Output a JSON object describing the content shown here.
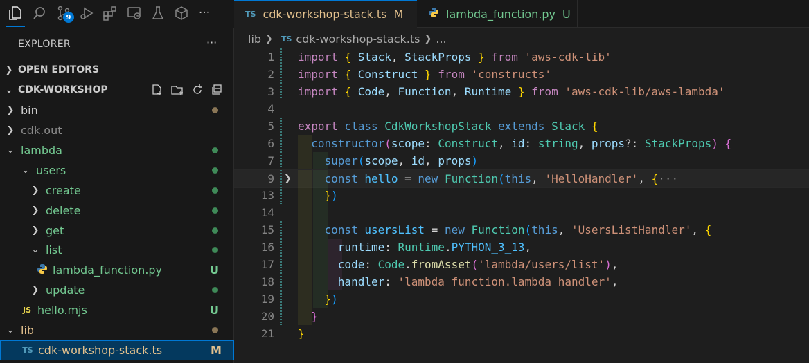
{
  "activity": {
    "badge_count": "9",
    "more": "···"
  },
  "sidebar": {
    "title": "EXPLORER",
    "more": "···",
    "open_editors": "OPEN EDITORS",
    "workspace": "CDK-WORKSHOP",
    "tree": [
      {
        "label": "bin",
        "status": ""
      },
      {
        "label": "cdk.out",
        "status": ""
      },
      {
        "label": "lambda",
        "status": ""
      },
      {
        "label": "users",
        "status": ""
      },
      {
        "label": "create",
        "status": ""
      },
      {
        "label": "delete",
        "status": ""
      },
      {
        "label": "get",
        "status": ""
      },
      {
        "label": "list",
        "status": ""
      },
      {
        "label": "lambda_function.py",
        "status": "U"
      },
      {
        "label": "update",
        "status": ""
      },
      {
        "label": "hello.mjs",
        "status": "U",
        "icon": "JS"
      },
      {
        "label": "lib",
        "status": ""
      },
      {
        "label": "cdk-workshop-stack.ts",
        "status": "M",
        "icon": "TS"
      }
    ]
  },
  "tabs": [
    {
      "label": "cdk-workshop-stack.ts",
      "status": "M",
      "icon": "TS"
    },
    {
      "label": "lambda_function.py",
      "status": "U"
    }
  ],
  "breadcrumb": {
    "folder": "lib",
    "icon": "TS",
    "file": "cdk-workshop-stack.ts",
    "tail": "..."
  },
  "editor": {
    "line_numbers": [
      "1",
      "2",
      "3",
      "4",
      "5",
      "6",
      "7",
      "9",
      "13",
      "14",
      "15",
      "16",
      "17",
      "18",
      "19",
      "20",
      "21"
    ],
    "lines": [
      {
        "t": [
          [
            "import ",
            "kw"
          ],
          [
            "{ ",
            "b1"
          ],
          [
            "Stack",
            "var"
          ],
          [
            ", ",
            ""
          ],
          [
            "StackProps",
            "var"
          ],
          [
            " }",
            "b1"
          ],
          [
            " from ",
            "kw"
          ],
          [
            "'aws-cdk-lib'",
            "str"
          ]
        ]
      },
      {
        "t": [
          [
            "import ",
            "kw"
          ],
          [
            "{ ",
            "b1"
          ],
          [
            "Construct",
            "var"
          ],
          [
            " }",
            "b1"
          ],
          [
            " from ",
            "kw"
          ],
          [
            "'constructs'",
            "str"
          ]
        ]
      },
      {
        "t": [
          [
            "import ",
            "kw"
          ],
          [
            "{ ",
            "b1"
          ],
          [
            "Code",
            "var"
          ],
          [
            ", ",
            ""
          ],
          [
            "Function",
            "var"
          ],
          [
            ", ",
            ""
          ],
          [
            "Runtime",
            "var"
          ],
          [
            " }",
            "b1"
          ],
          [
            " from ",
            "kw"
          ],
          [
            "'aws-cdk-lib/aws-lambda'",
            "str"
          ]
        ]
      },
      {
        "t": []
      },
      {
        "t": [
          [
            "export ",
            "kw"
          ],
          [
            "class ",
            "kwb"
          ],
          [
            "CdkWorkshopStack ",
            "tp"
          ],
          [
            "extends ",
            "kwb"
          ],
          [
            "Stack ",
            "tp"
          ],
          [
            "{",
            "b1"
          ]
        ]
      },
      {
        "t": [
          [
            "  ",
            ""
          ],
          [
            "constructor",
            "kwb"
          ],
          [
            "(",
            "b2"
          ],
          [
            "scope",
            "var"
          ],
          [
            ": ",
            ""
          ],
          [
            "Construct",
            "tp"
          ],
          [
            ", ",
            ""
          ],
          [
            "id",
            "var"
          ],
          [
            ": ",
            ""
          ],
          [
            "string",
            "tp"
          ],
          [
            ", ",
            ""
          ],
          [
            "props",
            "var"
          ],
          [
            "?: ",
            ""
          ],
          [
            "StackProps",
            "tp"
          ],
          [
            ")",
            "b2"
          ],
          [
            " {",
            "b2"
          ]
        ]
      },
      {
        "t": [
          [
            "    ",
            ""
          ],
          [
            "super",
            "kwb"
          ],
          [
            "(",
            "b3"
          ],
          [
            "scope",
            "var"
          ],
          [
            ", ",
            ""
          ],
          [
            "id",
            "var"
          ],
          [
            ", ",
            ""
          ],
          [
            "props",
            "var"
          ],
          [
            ")",
            "b3"
          ]
        ]
      },
      {
        "t": [
          [
            "    ",
            ""
          ],
          [
            "const ",
            "kwb"
          ],
          [
            "hello",
            "const"
          ],
          [
            " = ",
            ""
          ],
          [
            "new ",
            "kwb"
          ],
          [
            "Function",
            "tp"
          ],
          [
            "(",
            "b3"
          ],
          [
            "this",
            "kwb"
          ],
          [
            ", ",
            ""
          ],
          [
            "'HelloHandler'",
            "str"
          ],
          [
            ", ",
            ""
          ],
          [
            "{",
            "b1"
          ],
          [
            "···",
            "ellipsis"
          ]
        ]
      },
      {
        "t": [
          [
            "    ",
            ""
          ],
          [
            "}",
            "b1"
          ],
          [
            ")",
            "b3"
          ]
        ]
      },
      {
        "t": []
      },
      {
        "t": [
          [
            "    ",
            ""
          ],
          [
            "const ",
            "kwb"
          ],
          [
            "usersList",
            "const"
          ],
          [
            " = ",
            ""
          ],
          [
            "new ",
            "kwb"
          ],
          [
            "Function",
            "tp"
          ],
          [
            "(",
            "b3"
          ],
          [
            "this",
            "kwb"
          ],
          [
            ", ",
            ""
          ],
          [
            "'UsersListHandler'",
            "str"
          ],
          [
            ", ",
            ""
          ],
          [
            "{",
            "b1"
          ]
        ]
      },
      {
        "t": [
          [
            "      ",
            ""
          ],
          [
            "runtime",
            "var"
          ],
          [
            ": ",
            ""
          ],
          [
            "Runtime",
            "tp"
          ],
          [
            ".",
            ""
          ],
          [
            "PYTHON_3_13",
            "const"
          ],
          [
            ",",
            ""
          ]
        ]
      },
      {
        "t": [
          [
            "      ",
            ""
          ],
          [
            "code",
            "var"
          ],
          [
            ": ",
            ""
          ],
          [
            "Code",
            "tp"
          ],
          [
            ".",
            ""
          ],
          [
            "fromAsset",
            "fn"
          ],
          [
            "(",
            "b2"
          ],
          [
            "'lambda/users/list'",
            "str"
          ],
          [
            ")",
            "b2"
          ],
          [
            ",",
            ""
          ]
        ]
      },
      {
        "t": [
          [
            "      ",
            ""
          ],
          [
            "handler",
            "var"
          ],
          [
            ": ",
            ""
          ],
          [
            "'lambda_function.lambda_handler'",
            "str"
          ],
          [
            ",",
            ""
          ]
        ]
      },
      {
        "t": [
          [
            "    ",
            ""
          ],
          [
            "}",
            "b1"
          ],
          [
            ")",
            "b3"
          ]
        ]
      },
      {
        "t": [
          [
            "  ",
            ""
          ],
          [
            "}",
            "b2"
          ]
        ]
      },
      {
        "t": [
          [
            "}",
            "b1"
          ]
        ]
      }
    ]
  },
  "colors": {
    "accent": "#0078d4",
    "modified": "#e2c08d",
    "untracked": "#73c991",
    "dot_green": "#3f8a58",
    "dot_brown": "#8a7656"
  }
}
